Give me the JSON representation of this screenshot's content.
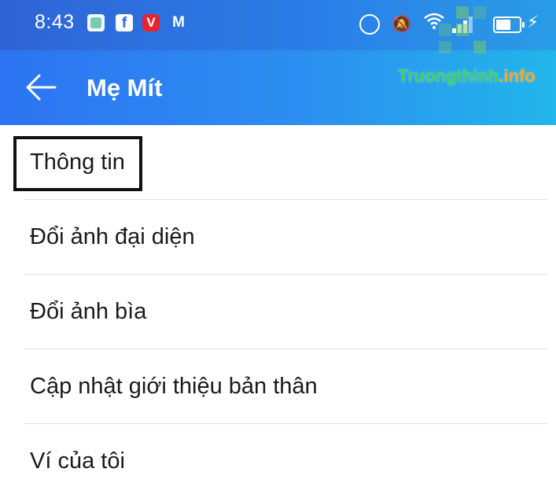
{
  "status_bar": {
    "time": "8:43",
    "notification_icons": [
      "chat-app-icon",
      "facebook-icon",
      "vivaldi-icon",
      "gmail-icon"
    ],
    "system_icons": [
      "alarm-icon",
      "mute-icon",
      "wifi-icon",
      "signal-icon",
      "battery-icon",
      "charging-icon"
    ]
  },
  "app_bar": {
    "title": "Mẹ Mít",
    "back_icon": "arrow-left-icon"
  },
  "watermark": {
    "text_main": "Truongthinh",
    "text_ext": ".info"
  },
  "menu": {
    "items": [
      {
        "label": "Thông tin"
      },
      {
        "label": "Đổi ảnh đại diện"
      },
      {
        "label": "Đổi ảnh bìa"
      },
      {
        "label": "Cập nhật giới thiệu bản thân"
      },
      {
        "label": "Ví của tôi"
      }
    ]
  },
  "colors": {
    "status_bar": "#2f63d6",
    "app_bar_start": "#2d74f2",
    "app_bar_end": "#22b6ea",
    "text": "#1a1a1a",
    "divider": "#e2e2e2",
    "highlight": "#111111"
  }
}
